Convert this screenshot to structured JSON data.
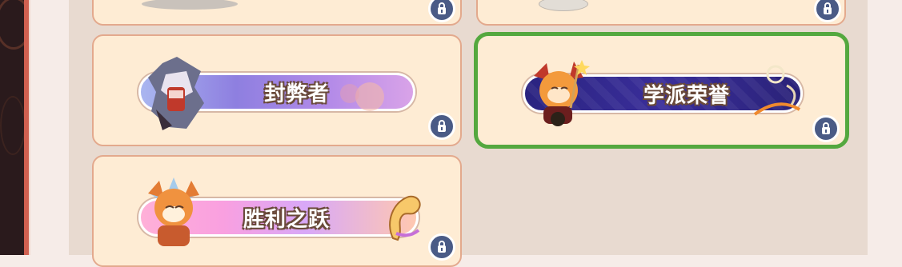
{
  "badges": [
    {
      "title": "封弊者",
      "locked": true,
      "selected": false
    },
    {
      "title": "学派荣誉",
      "locked": true,
      "selected": true
    },
    {
      "title": "胜利之跃",
      "locked": true,
      "selected": false
    }
  ],
  "icons": {
    "lock": "lock-icon"
  },
  "colors": {
    "selected_border": "#54a83f",
    "card_bg": "#feecd4",
    "lock_bg": "#4a5b86"
  }
}
